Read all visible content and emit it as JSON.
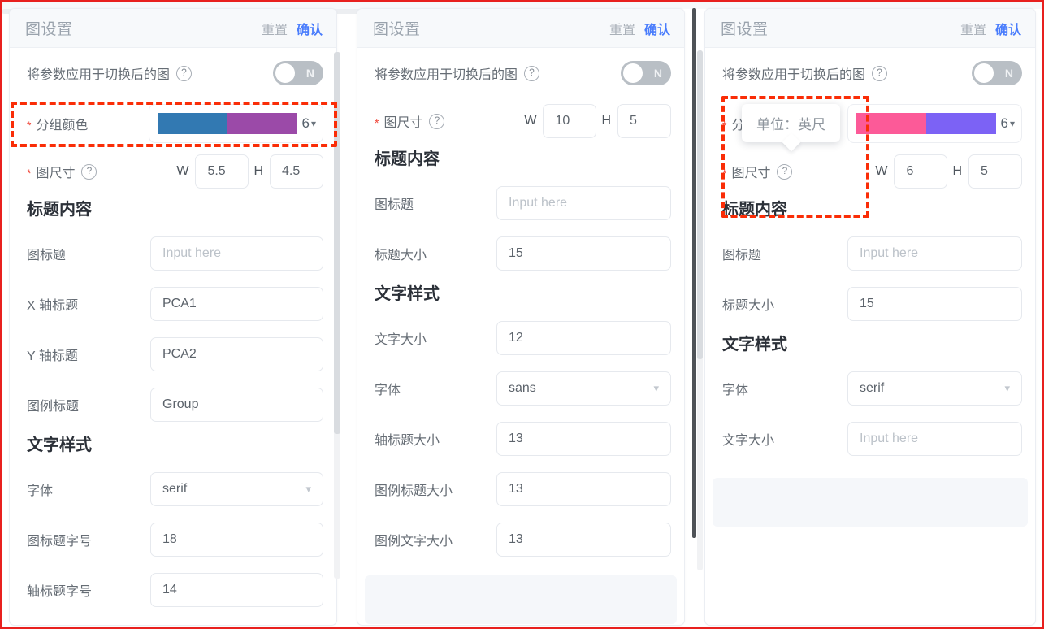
{
  "header": {
    "title": "图设置",
    "reset_label": "重置",
    "confirm_label": "确认"
  },
  "common": {
    "apply_switch_label": "将参数应用于切换后的图",
    "toggle_state_label": "N",
    "help_icon": "question-mark-circle-icon",
    "chevron_icon": "chevron-down-icon",
    "w_tag": "W",
    "h_tag": "H",
    "placeholder_input_here": "Input here",
    "required_marker": "*"
  },
  "labels": {
    "group_color": "分组颜色",
    "fig_size": "图尺寸",
    "title_section": "标题内容",
    "text_style_section": "文字样式",
    "chart_title": "图标题",
    "x_axis_title": "X 轴标题",
    "y_axis_title": "Y 轴标题",
    "legend_title": "图例标题",
    "font_family": "字体",
    "title_font_size": "图标题字号",
    "axis_title_font_size": "轴标题字号",
    "title_size": "标题大小",
    "text_size": "文字大小",
    "axis_title_size": "轴标题大小",
    "legend_title_size": "图例标题大小",
    "legend_text_size": "图例文字大小"
  },
  "panel1": {
    "palette": {
      "colors": [
        "#3279b2",
        "#9b4aa8"
      ],
      "count": "6"
    },
    "fig_size": {
      "w": "5.5",
      "h": "4.5"
    },
    "chart_title": "",
    "chart_title_placeholder": "Input here",
    "x_axis_title": "PCA1",
    "y_axis_title": "PCA2",
    "legend_title": "Group",
    "font_family": "serif",
    "title_font_size": "18",
    "axis_title_font_size": "14"
  },
  "panel2": {
    "fig_size": {
      "w": "10",
      "h": "5"
    },
    "chart_title": "",
    "chart_title_placeholder": "Input here",
    "title_size": "15",
    "text_size": "12",
    "font_family": "sans",
    "axis_title_size": "13",
    "legend_title_size": "13",
    "legend_text_size": "13"
  },
  "panel3": {
    "palette": {
      "colors": [
        "#fc5a98",
        "#7c62f5"
      ],
      "count": "6"
    },
    "fig_size": {
      "w": "6",
      "h": "5"
    },
    "chart_title": "",
    "chart_title_placeholder": "Input here",
    "title_size": "15",
    "font_family": "serif",
    "text_size": "",
    "text_size_placeholder": "Input here",
    "tooltip_text": "单位：英尺"
  },
  "colors": {
    "confirm_blue": "#4a7dfc",
    "annotation_red": "#fa2d07",
    "required_red": "#f04134"
  }
}
